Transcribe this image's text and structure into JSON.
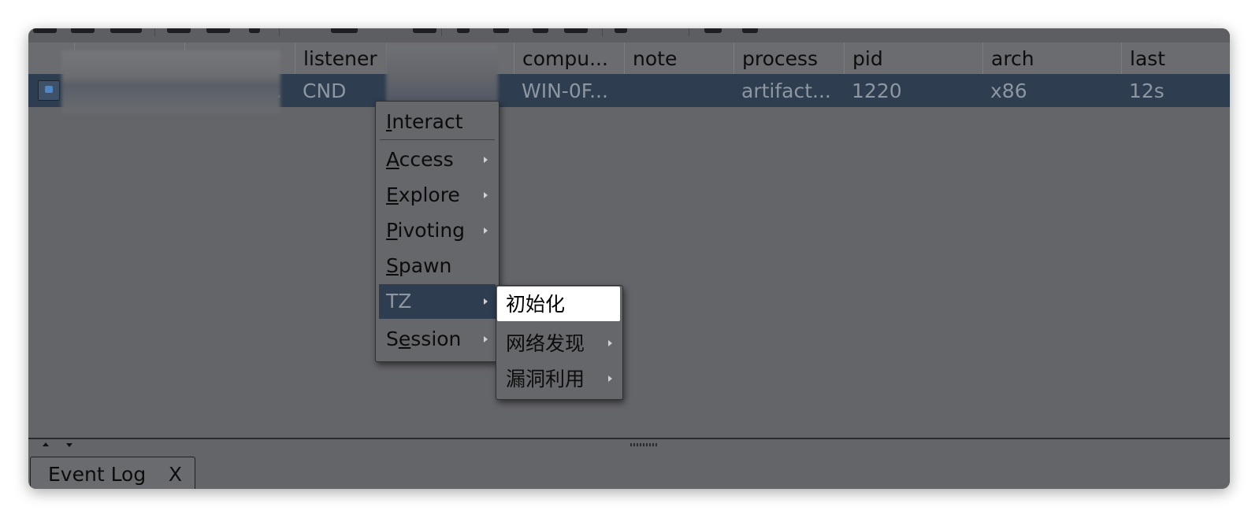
{
  "table": {
    "headers": [
      "",
      "",
      "",
      "listener",
      "",
      "compu...",
      "note",
      "process",
      "pid",
      "arch",
      "last"
    ],
    "row": {
      "listener": "CND",
      "computer": "WIN-0F...",
      "note": "",
      "process": "artifact...",
      "pid": "1220",
      "arch": "x86",
      "last": "12s",
      "user_trailing": "."
    }
  },
  "context_menu": {
    "items": [
      {
        "first": "I",
        "rest": "nteract"
      },
      {
        "first": "A",
        "rest": "ccess"
      },
      {
        "first": "E",
        "rest": "xplore"
      },
      {
        "first": "P",
        "rest": "ivoting"
      },
      {
        "first": "S",
        "rest": "pawn"
      },
      {
        "label": "TZ"
      },
      {
        "pre": "S",
        "first": "e",
        "rest": "ssion"
      }
    ]
  },
  "submenu": {
    "items": [
      "初始化",
      "网络发现",
      "漏洞利用"
    ]
  },
  "bottom_tab": {
    "label": "Event Log",
    "close": "X"
  }
}
